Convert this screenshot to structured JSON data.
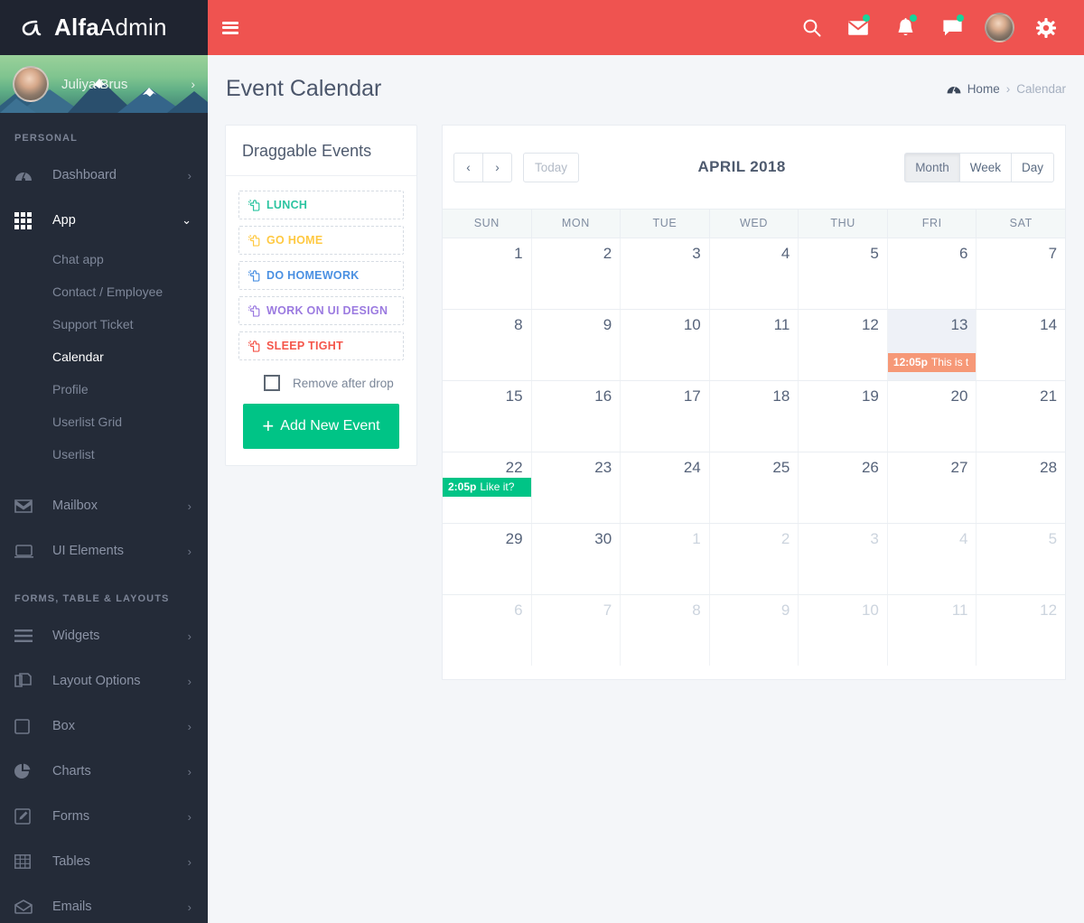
{
  "brand": {
    "logo_icon": "alpha-logo-icon",
    "name_bold": "Alfa",
    "name_light": "Admin"
  },
  "topbar": {
    "menu_icon": "hamburger-icon",
    "icons": [
      {
        "name": "search-icon",
        "badge": false
      },
      {
        "name": "mail-icon",
        "badge": true
      },
      {
        "name": "bell-icon",
        "badge": true
      },
      {
        "name": "chat-icon",
        "badge": true
      }
    ],
    "avatar": "user-avatar",
    "settings_icon": "gear-icon",
    "accent_color": "#ef5350",
    "badge_color": "#18d49a"
  },
  "sidebar": {
    "user": {
      "name": "Juliya Brus",
      "chevron": "›"
    },
    "section_personal": "PERSONAL",
    "section_forms": "FORMS, TABLE & LAYOUTS",
    "items_personal": [
      {
        "label": "Dashboard",
        "icon": "dashboard-icon",
        "chevron": "›",
        "active": false
      },
      {
        "label": "App",
        "icon": "grid-icon",
        "chevron": "⌄",
        "active": true
      }
    ],
    "app_subitems": [
      {
        "label": "Chat app",
        "active": false
      },
      {
        "label": "Contact / Employee",
        "active": false
      },
      {
        "label": "Support Ticket",
        "active": false
      },
      {
        "label": "Calendar",
        "active": true
      },
      {
        "label": "Profile",
        "active": false
      },
      {
        "label": "Userlist Grid",
        "active": false
      },
      {
        "label": "Userlist",
        "active": false
      }
    ],
    "items_personal_tail": [
      {
        "label": "Mailbox",
        "icon": "envelope-icon",
        "chevron": "›"
      },
      {
        "label": "UI Elements",
        "icon": "monitor-icon",
        "chevron": "›"
      }
    ],
    "items_forms": [
      {
        "label": "Widgets",
        "icon": "list-icon",
        "chevron": "›"
      },
      {
        "label": "Layout Options",
        "icon": "layers-icon",
        "chevron": "›"
      },
      {
        "label": "Box",
        "icon": "square-icon",
        "chevron": "›"
      },
      {
        "label": "Charts",
        "icon": "pie-chart-icon",
        "chevron": "›"
      },
      {
        "label": "Forms",
        "icon": "edit-icon",
        "chevron": "›"
      },
      {
        "label": "Tables",
        "icon": "table-icon",
        "chevron": "›"
      },
      {
        "label": "Emails",
        "icon": "open-envelope-icon",
        "chevron": "›"
      }
    ]
  },
  "page": {
    "title": "Event Calendar",
    "breadcrumb": {
      "icon": "dashboard-icon",
      "home": "Home",
      "sep": "›",
      "current": "Calendar"
    }
  },
  "draggable_panel": {
    "title": "Draggable Events",
    "events": [
      {
        "label": "LUNCH",
        "color": "#2bc4a0",
        "icon": "hand-pointer-icon"
      },
      {
        "label": "GO HOME",
        "color": "#ffc942",
        "icon": "hand-pointer-icon"
      },
      {
        "label": "DO HOMEWORK",
        "color": "#4a90e2",
        "icon": "hand-pointer-icon"
      },
      {
        "label": "WORK ON UI DESIGN",
        "color": "#9b7ae0",
        "icon": "hand-pointer-icon"
      },
      {
        "label": "SLEEP TIGHT",
        "color": "#f4554a",
        "icon": "hand-pointer-icon"
      }
    ],
    "remove_after_drop": {
      "label": "Remove after drop",
      "checked": false
    },
    "add_button": {
      "label": "Add New Event",
      "plus": "+",
      "color": "#00c486"
    }
  },
  "calendar": {
    "toolbar": {
      "prev": "‹",
      "next": "›",
      "today": "Today",
      "title": "APRIL 2018",
      "views": [
        {
          "label": "Month",
          "selected": true
        },
        {
          "label": "Week",
          "selected": false
        },
        {
          "label": "Day",
          "selected": false
        }
      ]
    },
    "day_headers": [
      "SUN",
      "MON",
      "TUE",
      "WED",
      "THU",
      "FRI",
      "SAT"
    ],
    "weeks": [
      [
        {
          "num": "1",
          "other": false,
          "today": false,
          "events": []
        },
        {
          "num": "2",
          "other": false,
          "today": false,
          "events": []
        },
        {
          "num": "3",
          "other": false,
          "today": false,
          "events": []
        },
        {
          "num": "4",
          "other": false,
          "today": false,
          "events": []
        },
        {
          "num": "5",
          "other": false,
          "today": false,
          "events": []
        },
        {
          "num": "6",
          "other": false,
          "today": false,
          "events": []
        },
        {
          "num": "7",
          "other": false,
          "today": false,
          "events": []
        }
      ],
      [
        {
          "num": "8",
          "other": false,
          "today": false,
          "events": []
        },
        {
          "num": "9",
          "other": false,
          "today": false,
          "events": []
        },
        {
          "num": "10",
          "other": false,
          "today": false,
          "events": []
        },
        {
          "num": "11",
          "other": false,
          "today": false,
          "events": []
        },
        {
          "num": "12",
          "other": false,
          "today": false,
          "events": []
        },
        {
          "num": "13",
          "other": false,
          "today": true,
          "events": [
            {
              "time": "12:05p",
              "title": "This is t",
              "style": "e-salmon",
              "color": "#f69877"
            }
          ]
        },
        {
          "num": "14",
          "other": false,
          "today": false,
          "events": []
        }
      ],
      [
        {
          "num": "15",
          "other": false,
          "today": false,
          "events": []
        },
        {
          "num": "16",
          "other": false,
          "today": false,
          "events": []
        },
        {
          "num": "17",
          "other": false,
          "today": false,
          "events": []
        },
        {
          "num": "18",
          "other": false,
          "today": false,
          "events": []
        },
        {
          "num": "19",
          "other": false,
          "today": false,
          "events": []
        },
        {
          "num": "20",
          "other": false,
          "today": false,
          "events": []
        },
        {
          "num": "21",
          "other": false,
          "today": false,
          "events": []
        }
      ],
      [
        {
          "num": "22",
          "other": false,
          "today": false,
          "events": [
            {
              "time": "2:05p",
              "title": "Like it?",
              "style": "e-green",
              "color": "#00c486"
            }
          ]
        },
        {
          "num": "23",
          "other": false,
          "today": false,
          "events": []
        },
        {
          "num": "24",
          "other": false,
          "today": false,
          "events": []
        },
        {
          "num": "25",
          "other": false,
          "today": false,
          "events": []
        },
        {
          "num": "26",
          "other": false,
          "today": false,
          "events": []
        },
        {
          "num": "27",
          "other": false,
          "today": false,
          "events": []
        },
        {
          "num": "28",
          "other": false,
          "today": false,
          "events": []
        }
      ],
      [
        {
          "num": "29",
          "other": false,
          "today": false,
          "events": []
        },
        {
          "num": "30",
          "other": false,
          "today": false,
          "events": []
        },
        {
          "num": "1",
          "other": true,
          "today": false,
          "events": []
        },
        {
          "num": "2",
          "other": true,
          "today": false,
          "events": []
        },
        {
          "num": "3",
          "other": true,
          "today": false,
          "events": []
        },
        {
          "num": "4",
          "other": true,
          "today": false,
          "events": []
        },
        {
          "num": "5",
          "other": true,
          "today": false,
          "events": []
        }
      ],
      [
        {
          "num": "6",
          "other": true,
          "today": false,
          "events": []
        },
        {
          "num": "7",
          "other": true,
          "today": false,
          "events": []
        },
        {
          "num": "8",
          "other": true,
          "today": false,
          "events": []
        },
        {
          "num": "9",
          "other": true,
          "today": false,
          "events": []
        },
        {
          "num": "10",
          "other": true,
          "today": false,
          "events": []
        },
        {
          "num": "11",
          "other": true,
          "today": false,
          "events": []
        },
        {
          "num": "12",
          "other": true,
          "today": false,
          "events": []
        }
      ]
    ]
  }
}
